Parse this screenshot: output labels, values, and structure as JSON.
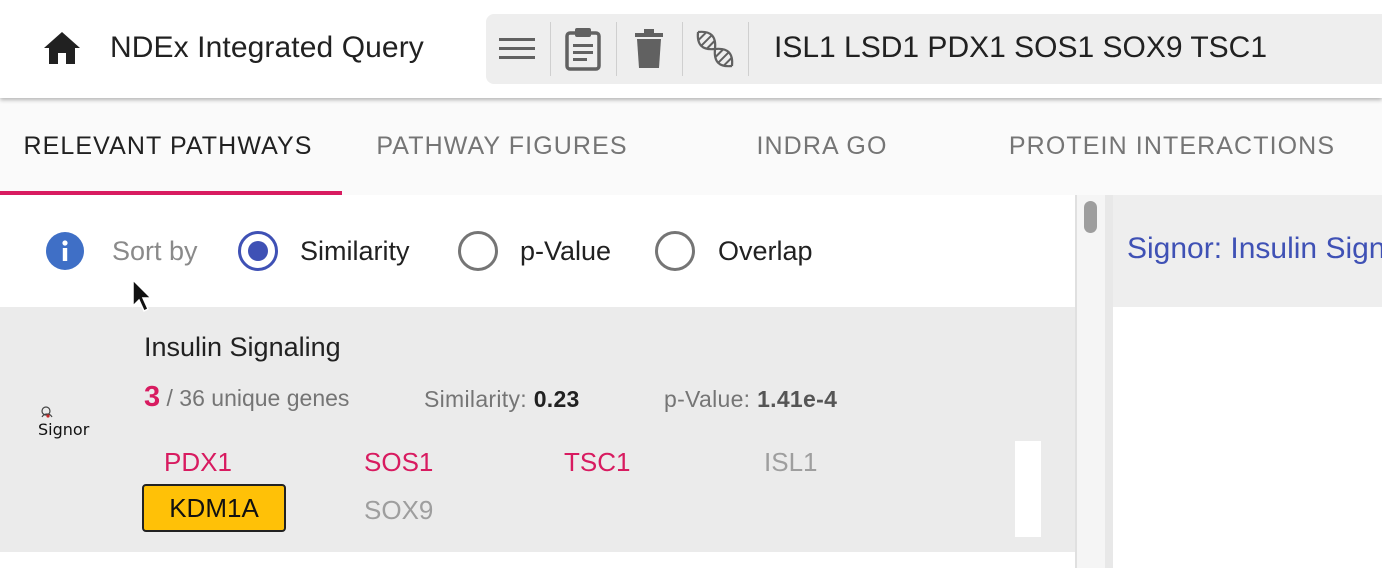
{
  "header": {
    "title": "NDEx Integrated Query",
    "query": "ISL1 LSD1 PDX1 SOS1 SOX9 TSC1",
    "icons": [
      "home-icon",
      "menu-icon",
      "clipboard-icon",
      "delete-icon",
      "dna-icon"
    ]
  },
  "tabs": [
    {
      "label": "RELEVANT PATHWAYS",
      "active": true
    },
    {
      "label": "PATHWAY FIGURES",
      "active": false
    },
    {
      "label": "INDRA GO",
      "active": false
    },
    {
      "label": "PROTEIN INTERACTIONS",
      "active": false
    }
  ],
  "sort": {
    "label": "Sort by",
    "options": [
      {
        "label": "Similarity",
        "selected": true
      },
      {
        "label": "p-Value",
        "selected": false
      },
      {
        "label": "Overlap",
        "selected": false
      }
    ]
  },
  "result": {
    "title": "Insulin Signaling",
    "source_logo": "Signor",
    "hits": "3",
    "genes_text": "/ 36 unique genes",
    "similarity_label": "Similarity:",
    "similarity_value": "0.23",
    "pvalue_label": "p-Value:",
    "pvalue_value": "1.41e-4",
    "genes": [
      {
        "name": "PDX1",
        "state": "hit"
      },
      {
        "name": "SOS1",
        "state": "hit"
      },
      {
        "name": "TSC1",
        "state": "hit"
      },
      {
        "name": "ISL1",
        "state": "miss"
      },
      {
        "name": "KDM1A",
        "state": "selected"
      },
      {
        "name": "SOX9",
        "state": "miss"
      }
    ]
  },
  "right_panel": {
    "title": "Signor: Insulin Signaling"
  },
  "colors": {
    "accent": "#d81b60",
    "primary": "#3f51b5",
    "chip": "#ffc107"
  }
}
